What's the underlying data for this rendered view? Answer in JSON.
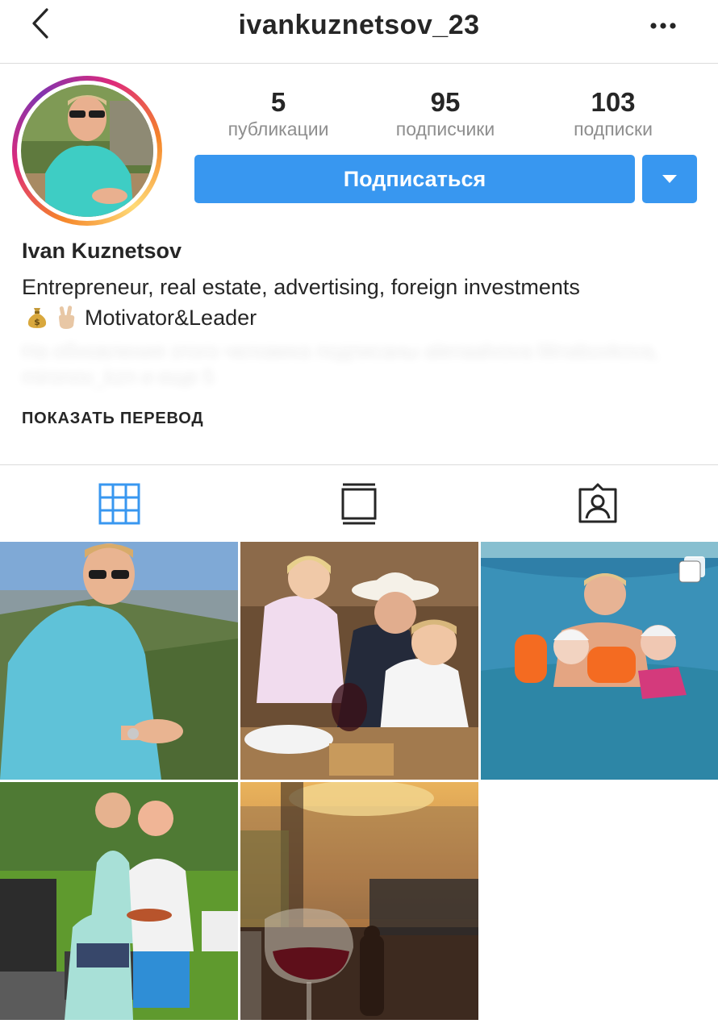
{
  "header": {
    "username": "ivankuznetsov_23",
    "back_icon": "chevron-left-icon",
    "more_icon": "ellipsis-icon"
  },
  "stats": [
    {
      "value": "5",
      "label": "публикации"
    },
    {
      "value": "95",
      "label": "подписчики"
    },
    {
      "value": "103",
      "label": "подписки"
    }
  ],
  "actions": {
    "follow_label": "Подписаться",
    "dropdown_icon": "caret-down-icon"
  },
  "profile": {
    "full_name": "Ivan Kuznetsov",
    "bio_line1": "Entrepreneur, real estate, advertising, foreign investments",
    "bio_line2": "Motivator&Leader",
    "followed_by": "На обновления этого человека подписаны alenaalvova lilinabuvkova, mironov_kzn и еще 5",
    "translate_label": "ПОКАЗАТЬ ПЕРЕВОД"
  },
  "tabs": [
    {
      "name": "grid",
      "icon": "grid-icon",
      "active": true
    },
    {
      "name": "feed",
      "icon": "feed-icon",
      "active": false
    },
    {
      "name": "tagged",
      "icon": "tagged-person-icon",
      "active": false
    }
  ],
  "colors": {
    "accent": "#3897f0",
    "text": "#262626",
    "secondary": "#8e8e8e",
    "divider": "#dbdbdb"
  },
  "posts": [
    {
      "id": "post-1",
      "multi": false
    },
    {
      "id": "post-2",
      "multi": false
    },
    {
      "id": "post-3",
      "multi": true
    },
    {
      "id": "post-4",
      "multi": false
    },
    {
      "id": "post-5",
      "multi": false
    }
  ]
}
